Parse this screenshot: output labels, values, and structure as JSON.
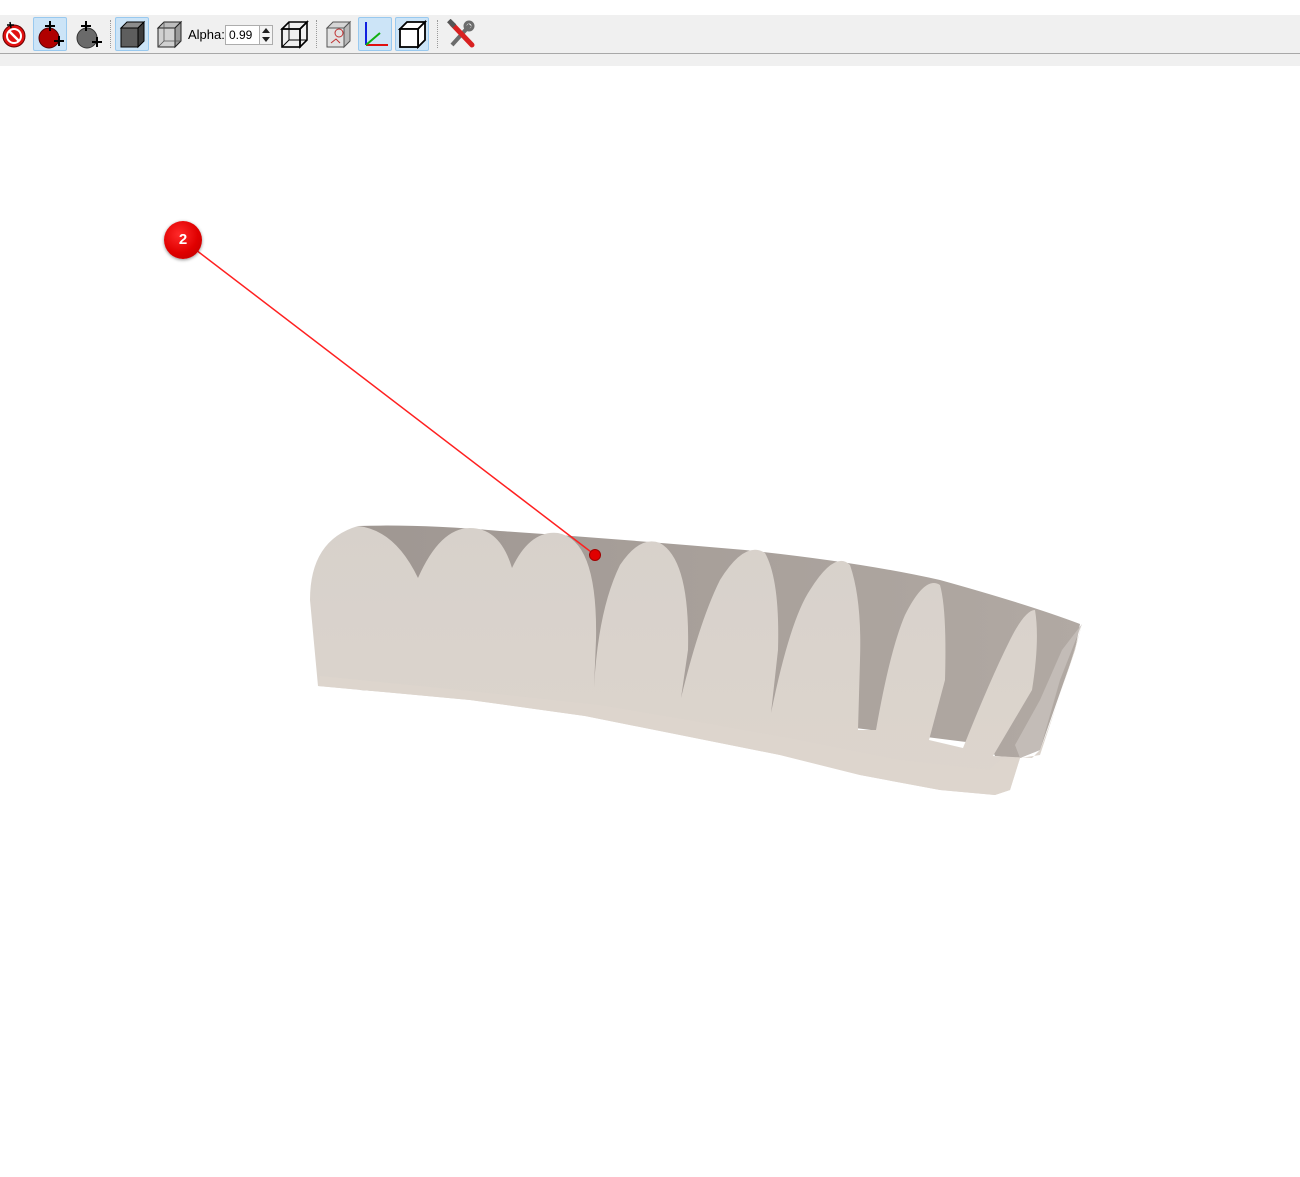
{
  "toolbar": {
    "buttons": [
      {
        "icon": "remove-selection-icon",
        "active": false
      },
      {
        "icon": "select-points-icon",
        "active": true
      },
      {
        "icon": "select-all-points-icon",
        "active": false
      },
      {
        "icon": "solid-view-icon",
        "active": true
      },
      {
        "icon": "transparent-view-icon",
        "active": false
      },
      {
        "icon": "wireframe-view-icon",
        "active": false
      },
      {
        "icon": "bounding-box-icon",
        "active": false
      },
      {
        "icon": "axes-icon",
        "active": true
      },
      {
        "icon": "perspective-box-icon",
        "active": true
      },
      {
        "icon": "tools-icon",
        "active": false
      }
    ],
    "alpha_label": "Alpha:",
    "alpha_value": "0.99"
  },
  "viewport": {
    "marker": {
      "label": "2",
      "color": "#e00000",
      "line_color": "#ff2020"
    },
    "model_colors": {
      "front": "#d9d2cc",
      "back": "#a69d97"
    }
  }
}
